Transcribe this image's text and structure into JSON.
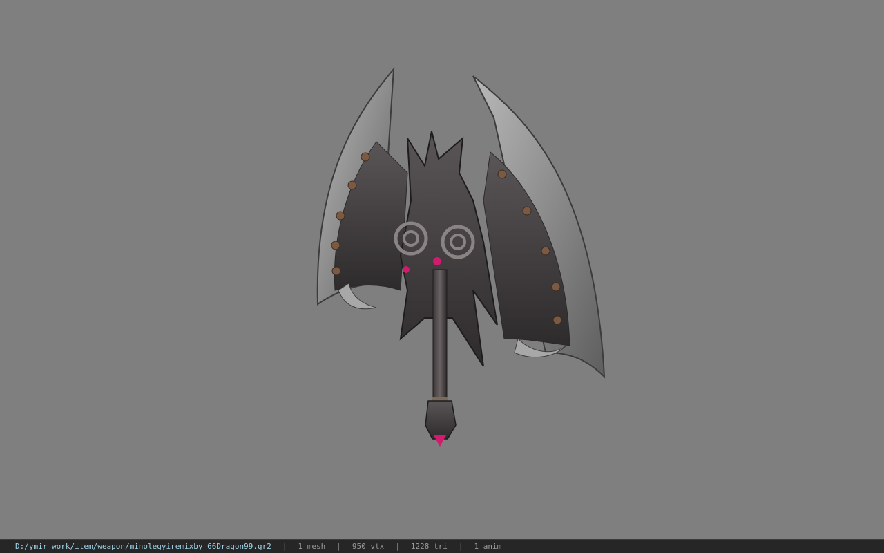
{
  "viewer": {
    "background_color": "#7f7f7f",
    "model_icon": "weapon-axe-model"
  },
  "status": {
    "file_path": "D:/ymir work/item/weapon/minolegyiremixby 66Dragon99.gr2",
    "separator": "|",
    "mesh_count": "1 mesh",
    "vertex_count": "950 vtx",
    "triangle_count": "1228 tri",
    "anim_count": "1 anim"
  }
}
